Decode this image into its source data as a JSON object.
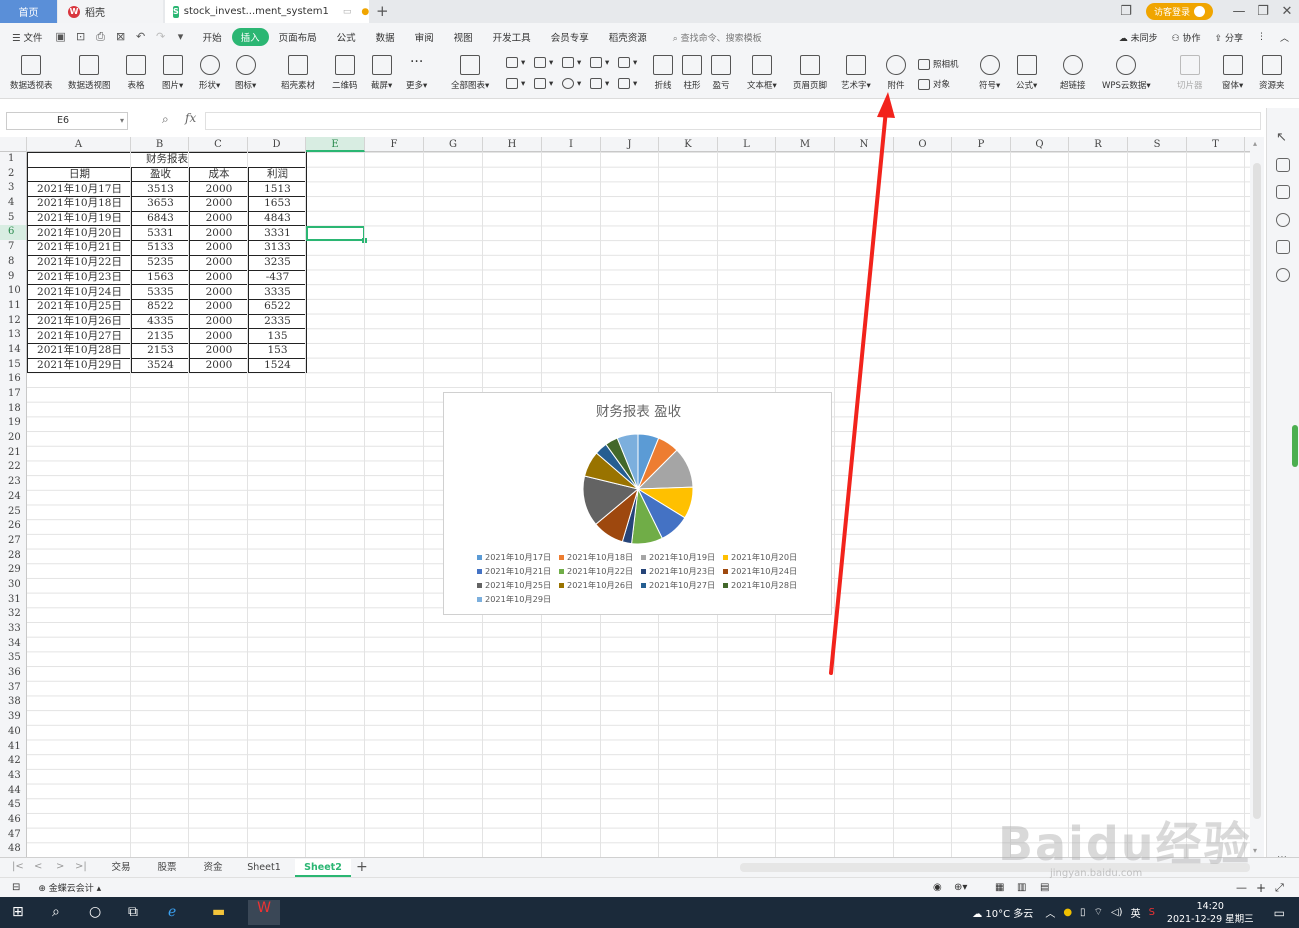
{
  "tabs": {
    "home": "首页",
    "daoke": "稻壳",
    "doc": "stock_invest...ment_system1",
    "login": "访客登录"
  },
  "menu": {
    "file": "文件",
    "items": [
      "开始",
      "插入",
      "页面布局",
      "公式",
      "数据",
      "审阅",
      "视图",
      "开发工具",
      "会员专享",
      "稻壳资源"
    ],
    "active_index": 1,
    "search": "查找命令、搜索模板",
    "unsync": "未同步",
    "collab": "协作",
    "share": "分享"
  },
  "ribbon": {
    "big": [
      {
        "label": "数据透视表",
        "icon": "pivot-table-icon"
      },
      {
        "label": "数据透视图",
        "icon": "pivot-chart-icon"
      },
      {
        "label": "表格",
        "icon": "table-icon"
      },
      {
        "label": "图片▾",
        "icon": "picture-icon"
      },
      {
        "label": "形状▾",
        "icon": "shape-icon"
      },
      {
        "label": "图标▾",
        "icon": "icon-library-icon"
      },
      {
        "label": "稻壳素材",
        "icon": "material-icon"
      },
      {
        "label": "二维码",
        "icon": "qrcode-icon"
      },
      {
        "label": "截屏▾",
        "icon": "screenshot-icon"
      },
      {
        "label": "更多▾",
        "icon": "more-icon"
      },
      {
        "label": "全部图表▾",
        "icon": "all-charts-icon"
      },
      {
        "label": "折线",
        "icon": "line-sparkline-icon"
      },
      {
        "label": "柱形",
        "icon": "column-sparkline-icon"
      },
      {
        "label": "盈亏",
        "icon": "winloss-icon"
      },
      {
        "label": "文本框▾",
        "icon": "textbox-icon"
      },
      {
        "label": "页眉页脚",
        "icon": "header-footer-icon"
      },
      {
        "label": "艺术字▾",
        "icon": "wordart-icon"
      },
      {
        "label": "附件",
        "icon": "attachment-icon"
      },
      {
        "label": "符号▾",
        "icon": "symbol-icon"
      },
      {
        "label": "公式▾",
        "icon": "formula-icon"
      },
      {
        "label": "超链接",
        "icon": "hyperlink-icon"
      },
      {
        "label": "WPS云数据▾",
        "icon": "cloud-data-icon"
      },
      {
        "label": "切片器",
        "icon": "slicer-icon"
      },
      {
        "label": "窗体▾",
        "icon": "form-icon"
      },
      {
        "label": "资源夹",
        "icon": "resource-icon"
      }
    ],
    "camera": "照相机",
    "object": "对象"
  },
  "formula_bar": {
    "cell_ref": "E6",
    "fx": "fx",
    "content": ""
  },
  "grid": {
    "columns": [
      "A",
      "B",
      "C",
      "D",
      "E",
      "F",
      "G",
      "H",
      "I",
      "J",
      "K",
      "L",
      "M",
      "N",
      "O",
      "P",
      "Q",
      "R",
      "S",
      "T"
    ],
    "selected_column": "E",
    "row_count": 48,
    "selected_row": 6
  },
  "sheet_table": {
    "title": "财务报表",
    "headers": [
      "日期",
      "盈收",
      "成本",
      "利润"
    ],
    "rows": [
      [
        "2021年10月17日",
        "3513",
        "2000",
        "1513"
      ],
      [
        "2021年10月18日",
        "3653",
        "2000",
        "1653"
      ],
      [
        "2021年10月19日",
        "6843",
        "2000",
        "4843"
      ],
      [
        "2021年10月20日",
        "5331",
        "2000",
        "3331"
      ],
      [
        "2021年10月21日",
        "5133",
        "2000",
        "3133"
      ],
      [
        "2021年10月22日",
        "5235",
        "2000",
        "3235"
      ],
      [
        "2021年10月23日",
        "1563",
        "2000",
        "-437"
      ],
      [
        "2021年10月24日",
        "5335",
        "2000",
        "3335"
      ],
      [
        "2021年10月25日",
        "8522",
        "2000",
        "6522"
      ],
      [
        "2021年10月26日",
        "4335",
        "2000",
        "2335"
      ],
      [
        "2021年10月27日",
        "2135",
        "2000",
        "135"
      ],
      [
        "2021年10月28日",
        "2153",
        "2000",
        "153"
      ],
      [
        "2021年10月29日",
        "3524",
        "2000",
        "1524"
      ]
    ]
  },
  "chart_data": {
    "type": "pie",
    "title": "财务报表 盈收",
    "categories": [
      "2021年10月17日",
      "2021年10月18日",
      "2021年10月19日",
      "2021年10月20日",
      "2021年10月21日",
      "2021年10月22日",
      "2021年10月23日",
      "2021年10月24日",
      "2021年10月25日",
      "2021年10月26日",
      "2021年10月27日",
      "2021年10月28日",
      "2021年10月29日"
    ],
    "values": [
      3513,
      3653,
      6843,
      5331,
      5133,
      5235,
      1563,
      5335,
      8522,
      4335,
      2135,
      2153,
      3524
    ],
    "colors": [
      "#5b9bd5",
      "#ed7d31",
      "#a5a5a5",
      "#ffc000",
      "#4472c4",
      "#70ad47",
      "#264478",
      "#9e480e",
      "#636363",
      "#997300",
      "#255e91",
      "#43682b",
      "#7cafdd"
    ],
    "legend": "bottom"
  },
  "sheets": {
    "tabs": [
      "交易",
      "股票",
      "资金",
      "Sheet1",
      "Sheet2"
    ],
    "active_index": 4
  },
  "status": {
    "account": "金蝶云会计 ▴"
  },
  "taskbar": {
    "weather": "10°C 多云",
    "ime": "英",
    "time": "14:20",
    "date": "2021-12-29 星期三"
  },
  "watermark": {
    "text": "Baidu经验",
    "sub": "jingyan.baidu.com"
  }
}
